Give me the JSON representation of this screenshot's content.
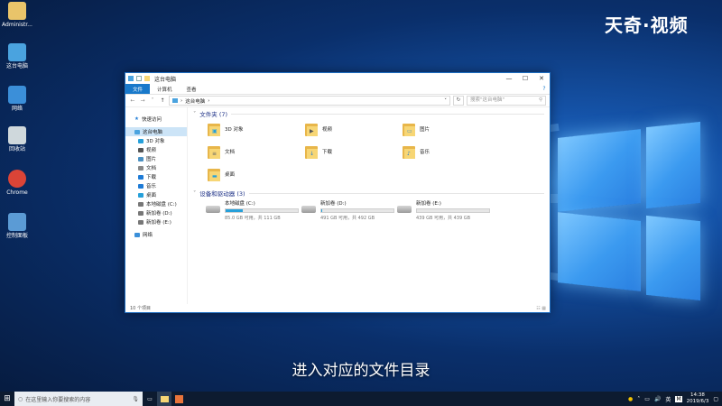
{
  "brand": "天奇·视频",
  "caption": "进入对应的文件目录",
  "desktop_icons": [
    {
      "label": "Administr...",
      "icon": "user-folder-icon",
      "color": "#e9c46a"
    },
    {
      "label": "这台电脑",
      "icon": "computer-icon",
      "color": "#4aa3df"
    },
    {
      "label": "网络",
      "icon": "network-icon",
      "color": "#3b8fd9"
    },
    {
      "label": "回收站",
      "icon": "recycle-bin-icon",
      "color": "#cfd8dc"
    },
    {
      "label": "Chrome",
      "icon": "chrome-icon",
      "color": "#db4437"
    },
    {
      "label": "控制面板",
      "icon": "control-panel-icon",
      "color": "#5b9bd5"
    }
  ],
  "window": {
    "title": "这台电脑",
    "ribbon_tabs": [
      "文件",
      "计算机",
      "查看"
    ],
    "address": "这台电脑",
    "search_placeholder": "搜索\"这台电脑\"",
    "nav": {
      "quick_access": "快速访问",
      "this_pc": "这台电脑",
      "children": [
        "3D 对象",
        "视频",
        "图片",
        "文档",
        "下载",
        "音乐",
        "桌面",
        "本地磁盘 (C:)",
        "新加卷 (D:)",
        "新加卷 (E:)"
      ],
      "network": "网络"
    },
    "folders_header": "文件夹 (7)",
    "folders": [
      {
        "name": "3D 对象",
        "glyph": "▣",
        "color": "#26a0da"
      },
      {
        "name": "视频",
        "glyph": "▶",
        "color": "#555"
      },
      {
        "name": "图片",
        "glyph": "▭",
        "color": "#4a90c2"
      },
      {
        "name": "文档",
        "glyph": "≡",
        "color": "#666"
      },
      {
        "name": "下载",
        "glyph": "↓",
        "color": "#1e7bd6"
      },
      {
        "name": "音乐",
        "glyph": "♪",
        "color": "#1e7bd6"
      },
      {
        "name": "桌面",
        "glyph": "▬",
        "color": "#26a0da"
      }
    ],
    "drives_header": "设备和驱动器 (3)",
    "drives": [
      {
        "name": "本地磁盘 (C:)",
        "free": "85.0 GB 可用，共 111 GB",
        "used_fraction": 0.24
      },
      {
        "name": "新加卷 (D:)",
        "free": "491 GB 可用，共 492 GB",
        "used_fraction": 0.01
      },
      {
        "name": "新加卷 (E:)",
        "free": "439 GB 可用，共 439 GB",
        "used_fraction": 0.0
      }
    ],
    "status_text": "10 个项目"
  },
  "taskbar": {
    "search_placeholder": "在这里输入你要搜索的内容",
    "ime": "英",
    "ime2": "M",
    "time": "14:38",
    "date": "2019/6/3"
  }
}
